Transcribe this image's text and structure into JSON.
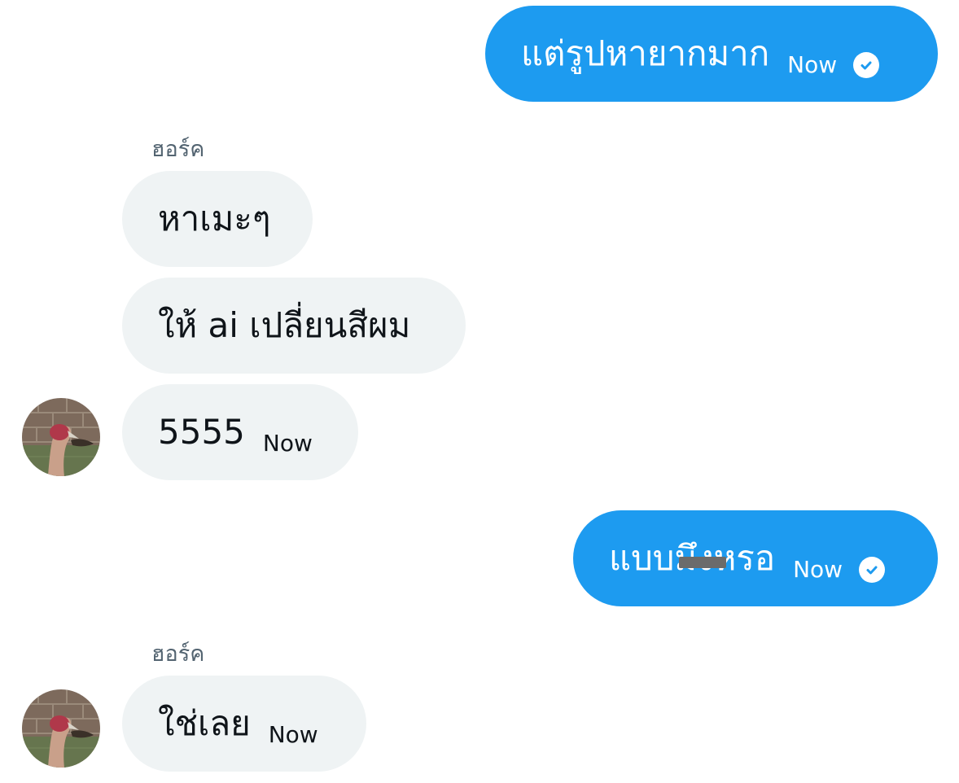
{
  "messages": [
    {
      "direction": "outgoing",
      "text": "แต่รูปหายากมาก",
      "time": "Now",
      "status_icon": "check-circle-icon"
    },
    {
      "direction": "incoming",
      "sender": "ฮอร์ค",
      "text": "หาเมะๆ"
    },
    {
      "direction": "incoming",
      "text": "ให้ ai เปลี่ยนสีผม"
    },
    {
      "direction": "incoming",
      "text": "5555",
      "time": "Now",
      "avatar": "avatar-bird-on-brick-wall"
    },
    {
      "direction": "outgoing",
      "text": "แบบมึงหรอ",
      "time": "Now",
      "status_icon": "check-circle-icon",
      "redacted_overlay": true
    },
    {
      "direction": "incoming",
      "sender": "ฮอร์ค",
      "text": "ใช่เลย",
      "time": "Now",
      "avatar": "avatar-bird-on-brick-wall"
    }
  ],
  "colors": {
    "outgoing_bubble": "#1d9bf0",
    "incoming_bubble": "#eff3f4",
    "sender_name": "#536471",
    "redaction": "#6b6b6b"
  }
}
